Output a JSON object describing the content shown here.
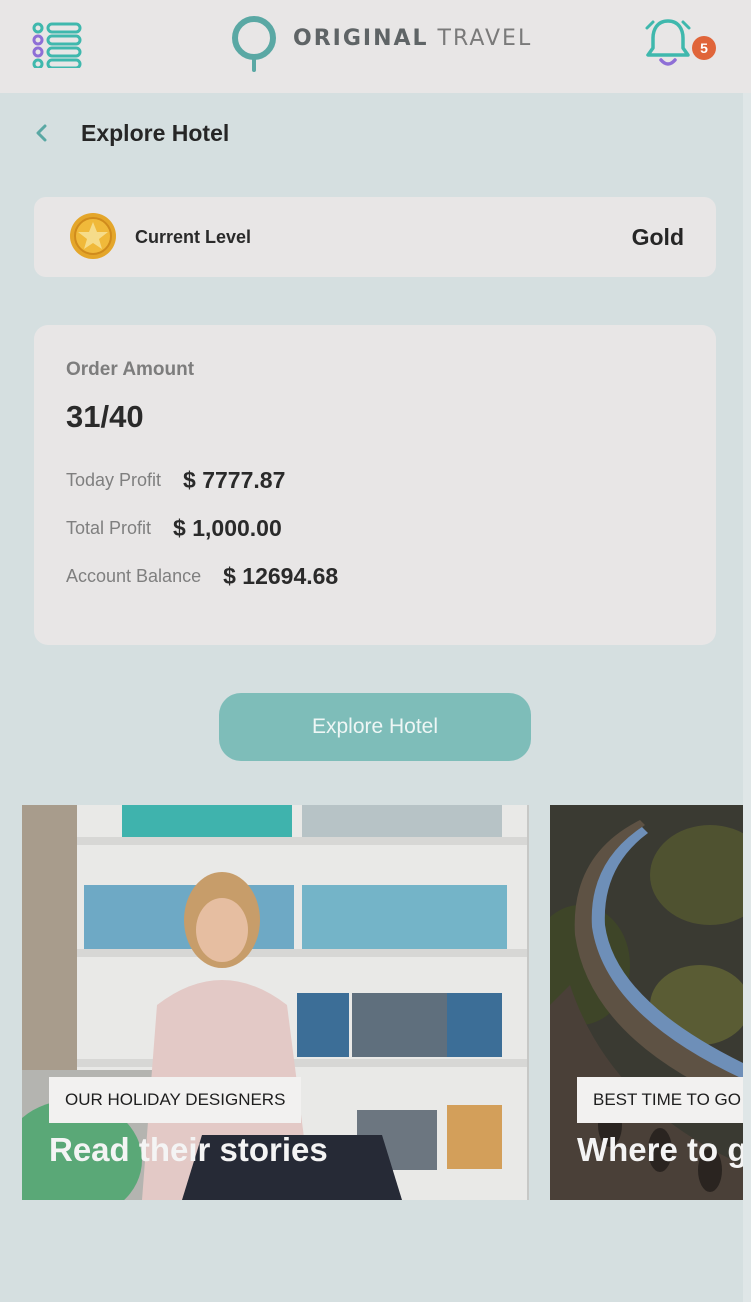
{
  "header": {
    "brand_bold": "ORIGINAL",
    "brand_light": "TRAVEL",
    "notification_count": "5",
    "accent_color": "#3fb8ad"
  },
  "page": {
    "title": "Explore Hotel"
  },
  "level": {
    "label": "Current Level",
    "value": "Gold"
  },
  "order": {
    "amount_label": "Order Amount",
    "amount_value": "31/40",
    "today_profit_label": "Today Profit",
    "today_profit_value": "$ 7777.87",
    "total_profit_label": "Total Profit",
    "total_profit_value": "$ 1,000.00",
    "balance_label": "Account Balance",
    "balance_value": "$ 12694.68"
  },
  "actions": {
    "explore_label": "Explore Hotel"
  },
  "promos": [
    {
      "tag": "OUR HOLIDAY DESIGNERS",
      "headline": "Read their stories"
    },
    {
      "tag": "BEST TIME TO GO",
      "headline": "Where to go"
    }
  ]
}
